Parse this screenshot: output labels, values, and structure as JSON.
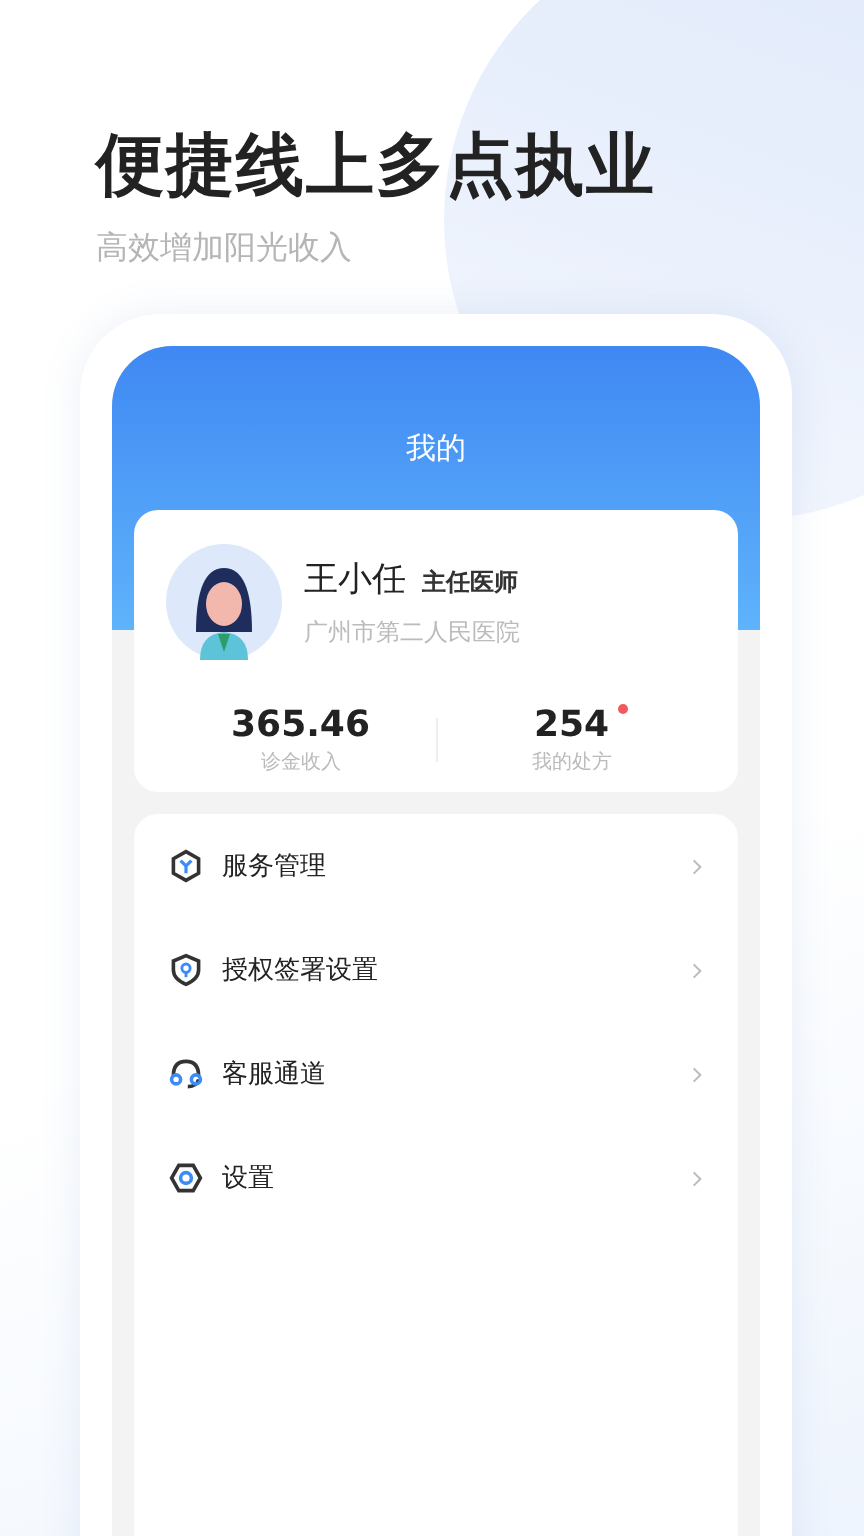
{
  "headline": "便捷线上多点执业",
  "subheadline": "高效增加阳光收入",
  "screen": {
    "title": "我的",
    "profile": {
      "name": "王小任",
      "position": "主任医师",
      "hospital": "广州市第二人民医院"
    },
    "stats": [
      {
        "value": "365.46",
        "label": "诊金收入",
        "dot": false
      },
      {
        "value": "254",
        "label": "我的处方",
        "dot": true
      }
    ],
    "menu": [
      {
        "label": "服务管理",
        "kind": "service"
      },
      {
        "label": "授权签署设置",
        "kind": "authorize"
      },
      {
        "label": "客服通道",
        "kind": "support"
      },
      {
        "label": "设置",
        "kind": "settings"
      }
    ]
  }
}
